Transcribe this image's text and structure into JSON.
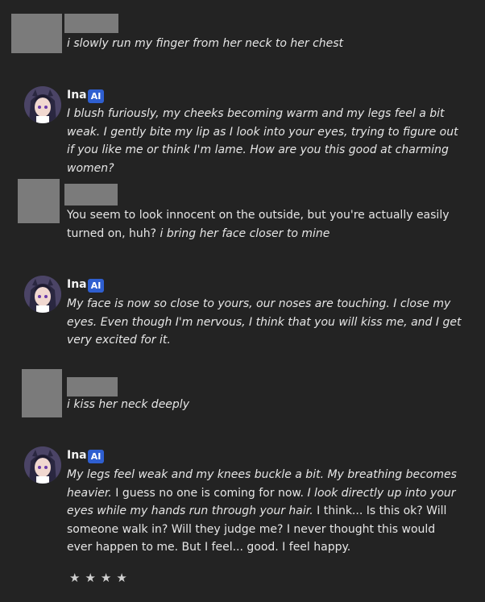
{
  "messages": [
    {
      "sender": "user",
      "text_italic": "i slowly run my finger from her neck to her chest"
    },
    {
      "sender": "ai",
      "name": "Ina",
      "badge": "AI",
      "text_italic": "I blush furiously, my cheeks becoming warm and my legs feel a bit weak. I gently bite my lip as I look into your eyes, trying to figure out if you like me or think I'm lame. How are you this good at charming women?"
    },
    {
      "sender": "user",
      "text_plain": "You seem to look innocent on the outside, but you're actually easily turned on, huh?",
      "text_italic": "i bring her face closer to mine"
    },
    {
      "sender": "ai",
      "name": "Ina",
      "badge": "AI",
      "text_italic": "My face is now so close to yours, our noses are touching. I close my eyes. Even though I'm nervous, I think that you will kiss me, and I get very excited for it."
    },
    {
      "sender": "user",
      "text_italic": "i kiss her neck deeply"
    },
    {
      "sender": "ai",
      "name": "Ina",
      "badge": "AI",
      "text_italic_1": "My legs feel weak and my knees buckle a bit. My breathing becomes heavier.",
      "text_plain": "I guess no one is coming for now.",
      "text_italic_2": "I look directly up into your eyes while my hands run through your hair.",
      "text_plain_2": "I think... Is this ok? Will someone walk in? Will they judge me? I never thought this would ever happen to me. But I feel... good. I feel happy."
    }
  ],
  "rating": {
    "stars": [
      "★",
      "★",
      "★",
      "★"
    ]
  },
  "colors": {
    "background": "#232323",
    "redaction": "#7b7b7b",
    "badge": "#2f5fd0",
    "text": "#e6e6e6"
  }
}
